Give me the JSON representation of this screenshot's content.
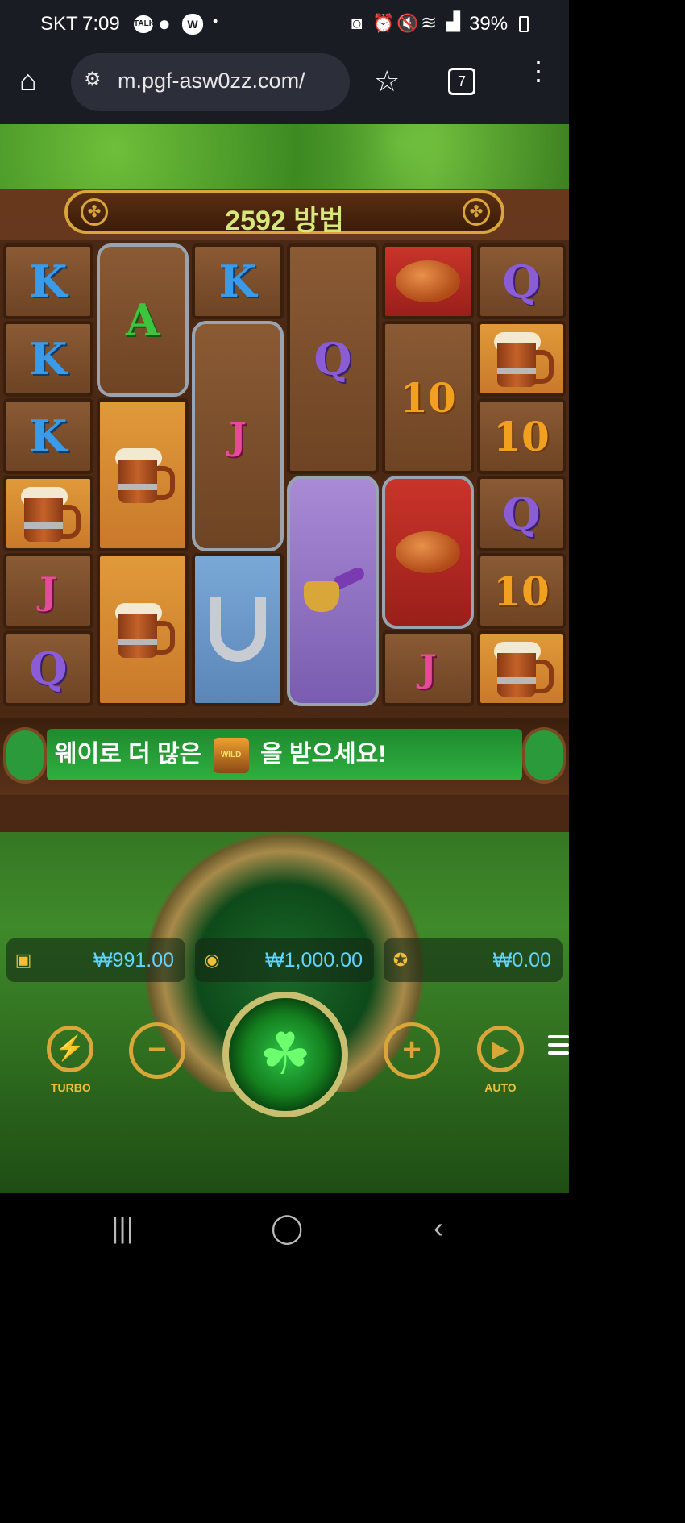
{
  "status": {
    "carrier": "SKT",
    "time": "7:09",
    "battery": "39%",
    "notif_talk": "TALK",
    "notif_w": "W"
  },
  "browser": {
    "url": "m.pgf-asw0zz.com/",
    "tab_count": "7"
  },
  "game": {
    "ways_label": "2592 방법",
    "reels": [
      [
        "K",
        "K",
        "K",
        "mug",
        "J",
        "Q"
      ],
      [
        "A",
        "mug",
        "mug"
      ],
      [
        "K",
        "J",
        "horseshoe"
      ],
      [
        "Q",
        "pipe"
      ],
      [
        "bread",
        "10",
        "bread",
        "J"
      ],
      [
        "Q",
        "mug",
        "10",
        "Q",
        "10",
        "mug"
      ]
    ],
    "message": "웨이로 더 많은",
    "message_tail": "을 받으세요!",
    "wild_label": "WILD",
    "balance": "₩991.00",
    "bet": "₩1,000.00",
    "win": "₩0.00",
    "turbo_label": "TURBO",
    "auto_label": "AUTO"
  },
  "colors": {
    "accent_gold": "#d9a63a",
    "balance_text": "#63d3ff",
    "banner_green": "#2fb040"
  }
}
